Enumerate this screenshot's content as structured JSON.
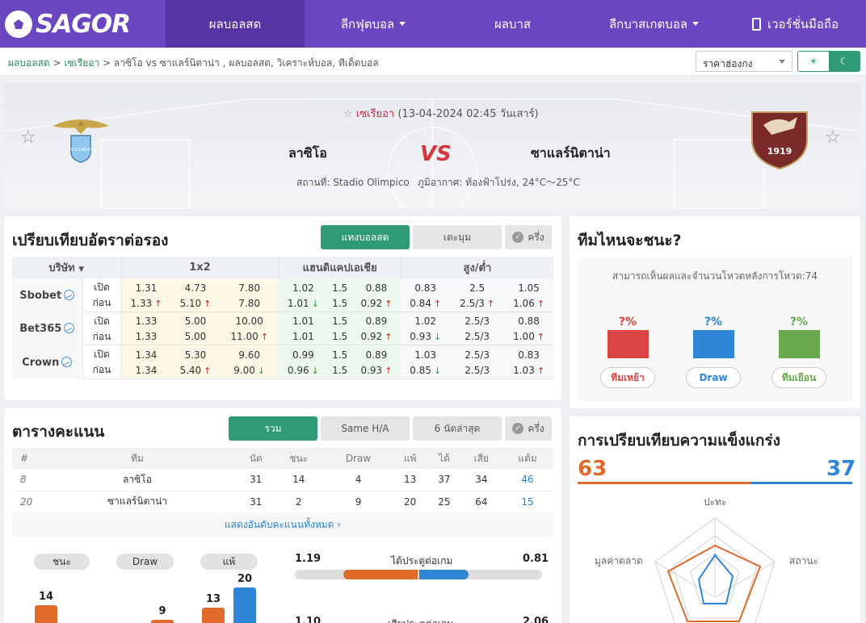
{
  "header": {
    "logo_text": "SAGOR",
    "nav": [
      {
        "label": "ผลบอลสด",
        "active": true
      },
      {
        "label": "ลีกฟุตบอล",
        "dropdown": true
      },
      {
        "label": "ผลบาส"
      },
      {
        "label": "ลีกบาสเกตบอล",
        "dropdown": true
      },
      {
        "label": "เวอร์ชั่นมือถือ"
      }
    ]
  },
  "breadcrumb": {
    "home": "ผลบอลสด",
    "sep1": ">",
    "league": "เซเรียอา",
    "sep2": ">",
    "current": "ลาซิโอ vs  ซาแลร์นิตาน่า ,  ผลบอลสด,  วิเคราะห์บอล,  ทีเด็ดบอล"
  },
  "odds_select": {
    "value": "ราคาฮ่องกง"
  },
  "theme_toggle": {
    "light": "☀",
    "dark": "☾"
  },
  "match": {
    "league": "เซเรียอา",
    "datetime": "(13-04-2024 02:45 วันเสาร์)",
    "home": "ลาซิโอ",
    "away": "ซาแลร์นิตาน่า",
    "vs": "VS",
    "venue": "สถานที่: Stadio Olimpico",
    "weather": "ภูมิอากาศ: ท้องฟ้าโปร่ง, 24°C～25°C",
    "home_logo_text": "S.S.LAZIO",
    "away_logo_text": "1919"
  },
  "odds": {
    "title": "เปรียบเทียบอัตราต่อรอง",
    "tabs": [
      "แทงบอลสด",
      "เตะมุม"
    ],
    "half_label": "ครึ่ง",
    "headers": {
      "company": "บริษัท",
      "h1x2": "1x2",
      "handicap": "แฮนดิแคปเอเชีย",
      "ou": "สูง/ต่ำ"
    },
    "open_label": "เปิด",
    "close_label": "ก่อน",
    "rows": [
      {
        "company": "Sbobet",
        "open": [
          "1.31",
          "4.73",
          "7.80",
          "1.02",
          "1.5",
          "0.88",
          "0.83",
          "2.5",
          "1.05"
        ],
        "close": [
          "1.33",
          "5.10",
          "7.80",
          "1.01",
          "1.5",
          "0.92",
          "0.84",
          "2.5/3",
          "1.06"
        ],
        "dir": [
          "u",
          "u",
          "",
          "d",
          "",
          "u",
          "u",
          "u",
          "u"
        ]
      },
      {
        "company": "Bet365",
        "open": [
          "1.33",
          "5.00",
          "10.00",
          "1.01",
          "1.5",
          "0.89",
          "1.02",
          "2.5/3",
          "0.88"
        ],
        "close": [
          "1.33",
          "5.00",
          "11.00",
          "1.01",
          "1.5",
          "0.92",
          "0.93",
          "2.5/3",
          "1.00"
        ],
        "dir": [
          "",
          "",
          "u",
          "",
          "",
          "u",
          "d",
          "",
          "u"
        ]
      },
      {
        "company": "Crown",
        "open": [
          "1.34",
          "5.30",
          "9.60",
          "0.99",
          "1.5",
          "0.89",
          "1.03",
          "2.5/3",
          "0.83"
        ],
        "close": [
          "1.34",
          "5.40",
          "9.00",
          "0.96",
          "1.5",
          "0.93",
          "0.85",
          "2.5/3",
          "1.03"
        ],
        "dir": [
          "",
          "u",
          "d",
          "d",
          "",
          "u",
          "d",
          "",
          "u"
        ]
      }
    ]
  },
  "winner": {
    "title": "ทีมไหนจะชนะ?",
    "note": "สามารถเห็นผลและจำนวนโหวตหลังการโหวต:74",
    "options": [
      {
        "pct": "?%",
        "label": "ทีมเหย้า",
        "color": "#d94545"
      },
      {
        "pct": "?%",
        "label": "Draw",
        "color": "#2f86d6"
      },
      {
        "pct": "?%",
        "label": "ทีมเยือน",
        "color": "#6aa84f"
      }
    ]
  },
  "standings": {
    "title": "ตารางคะแนน",
    "tabs": [
      "รวม",
      "Same H/A",
      "6 นัดล่าสุด"
    ],
    "half_label": "ครึ่ง",
    "headers": [
      "#",
      "ทีม",
      "นัด",
      "ชนะ",
      "Draw",
      "แพ้",
      "ได้",
      "เสีย",
      "แต้ม"
    ],
    "rows": [
      [
        "8",
        "ลาซิโอ",
        "31",
        "14",
        "4",
        "13",
        "37",
        "34",
        "46"
      ],
      [
        "20",
        "ซาแลร์นิตาน่า",
        "31",
        "2",
        "9",
        "20",
        "25",
        "64",
        "15"
      ]
    ],
    "more": "แสดงอันดับคะแนนทั้งหมด  ›"
  },
  "record": {
    "pills": [
      "ชนะ",
      "Draw",
      "แพ้"
    ],
    "bars": [
      {
        "value": 14,
        "color": "#e06a2a"
      },
      {
        "value": 9,
        "color": "#e06a2a"
      },
      {
        "value": 13,
        "color": "#e06a2a"
      },
      {
        "value": 20,
        "color": "#2f86d6"
      }
    ]
  },
  "compare_goals": [
    {
      "home": "1.19",
      "label": "ได้ประตูต่อเกม",
      "away": "0.81"
    },
    {
      "home": "1.10",
      "label": "เสียประตูต่อเกม",
      "away": "2.06"
    }
  ],
  "strength": {
    "title": "การเปรียบเทียบความแข็งแกร่ง",
    "home": "63",
    "away": "37",
    "home_color": "#e06a2a",
    "away_color": "#2f86d6",
    "axes": [
      "ปะทะ",
      "สถานะ",
      "มูลค่าตลาด"
    ]
  }
}
